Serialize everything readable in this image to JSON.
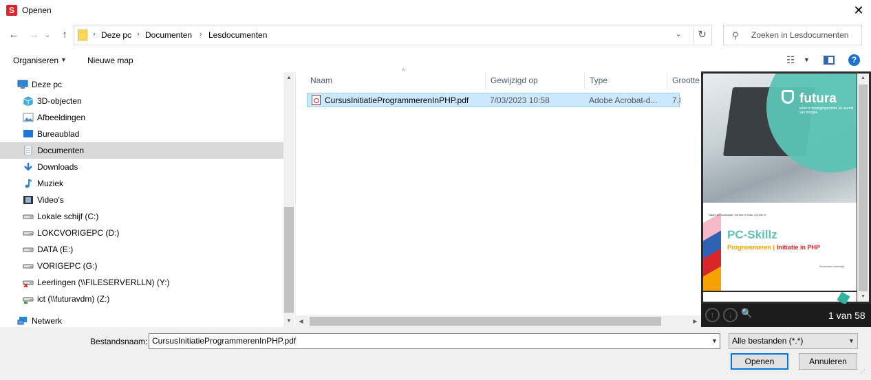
{
  "window": {
    "title": "Openen",
    "app_icon_letter": "S",
    "close_glyph": "✕"
  },
  "nav_buttons": {
    "back": "←",
    "forward": "→",
    "recent": "⌄",
    "up": "↑"
  },
  "breadcrumb": {
    "sep": "›",
    "items": [
      "Deze pc",
      "Documenten",
      "Lesdocumenten"
    ],
    "dropdown": "⌄",
    "refresh": "↻"
  },
  "search": {
    "placeholder": "Zoeken in Lesdocumenten",
    "icon": "⚲"
  },
  "toolbar": {
    "organize": "Organiseren",
    "new_folder": "Nieuwe map",
    "view_icon": "☷",
    "help": "?"
  },
  "sidebar": {
    "items": [
      {
        "label": "Deze pc",
        "icon": "computer-icon",
        "color": "#2b88d8"
      },
      {
        "label": "3D-objecten",
        "icon": "cube-icon",
        "color": "#3fb0e6"
      },
      {
        "label": "Afbeeldingen",
        "icon": "pictures-icon",
        "color": "#7a8fa6"
      },
      {
        "label": "Bureaublad",
        "icon": "desktop-icon",
        "color": "#1e78d2"
      },
      {
        "label": "Documenten",
        "icon": "documents-icon",
        "color": "#8ca0b3",
        "selected": true
      },
      {
        "label": "Downloads",
        "icon": "download-icon",
        "color": "#2b79d6"
      },
      {
        "label": "Muziek",
        "icon": "music-icon",
        "color": "#2b88d8"
      },
      {
        "label": "Video's",
        "icon": "video-icon",
        "color": "#333333"
      },
      {
        "label": "Lokale schijf (C:)",
        "icon": "drive-icon",
        "color": "#5c5c5c"
      },
      {
        "label": "LOKCVORIGEPC (D:)",
        "icon": "drive-icon",
        "color": "#5c5c5c"
      },
      {
        "label": "DATA (E:)",
        "icon": "drive-icon",
        "color": "#5c5c5c"
      },
      {
        "label": "VORIGEPC (G:)",
        "icon": "drive-icon",
        "color": "#5c5c5c"
      },
      {
        "label": "Leerlingen (\\\\FILESERVERLLN) (Y:)",
        "icon": "network-drive-disconnected-icon",
        "color": "#d9262a"
      },
      {
        "label": "ict (\\\\futuravdm) (Z:)",
        "icon": "network-drive-icon",
        "color": "#3a9f3a"
      },
      {
        "label": "Netwerk",
        "icon": "network-icon",
        "color": "#2b88d8"
      }
    ]
  },
  "filelist": {
    "columns": [
      "Naam",
      "Gewijzigd op",
      "Type",
      "Grootte"
    ],
    "rows": [
      {
        "name": "CursusInitiatieProgrammerenInPHP.pdf",
        "modified": "7/03/2023 10:58",
        "type": "Adobe Acrobat-d...",
        "size": "7.8"
      }
    ]
  },
  "preview": {
    "brand": "futura",
    "tagline": "leren is bewegingsruimte de wereld van morgen",
    "meta_line": "Naam en voornaam: Vul hier in                Klas: Vul hier in",
    "heading": "PC-Skillz",
    "subtitle_left": "Programmeren | ",
    "subtitle_right": "Initiatie in PHP",
    "small_text": "Secundair onderwijs",
    "page_count": "1 van 58",
    "prev_glyph": "↑",
    "next_glyph": "↓",
    "find_glyph": "🔍",
    "colors": {
      "teal": "#5cc3b4",
      "orange": "#f4a300",
      "red": "#d9262a"
    }
  },
  "footer": {
    "filename_label": "Bestandsnaam:",
    "filename_value": "CursusInitiatieProgrammerenInPHP.pdf",
    "filter_value": "Alle bestanden (*.*)",
    "open_label": "Openen",
    "cancel_label": "Annuleren"
  },
  "scroll": {
    "up": "▲",
    "down": "▼",
    "left": "◀",
    "right": "▶",
    "caret": "▼",
    "sort": "^"
  }
}
